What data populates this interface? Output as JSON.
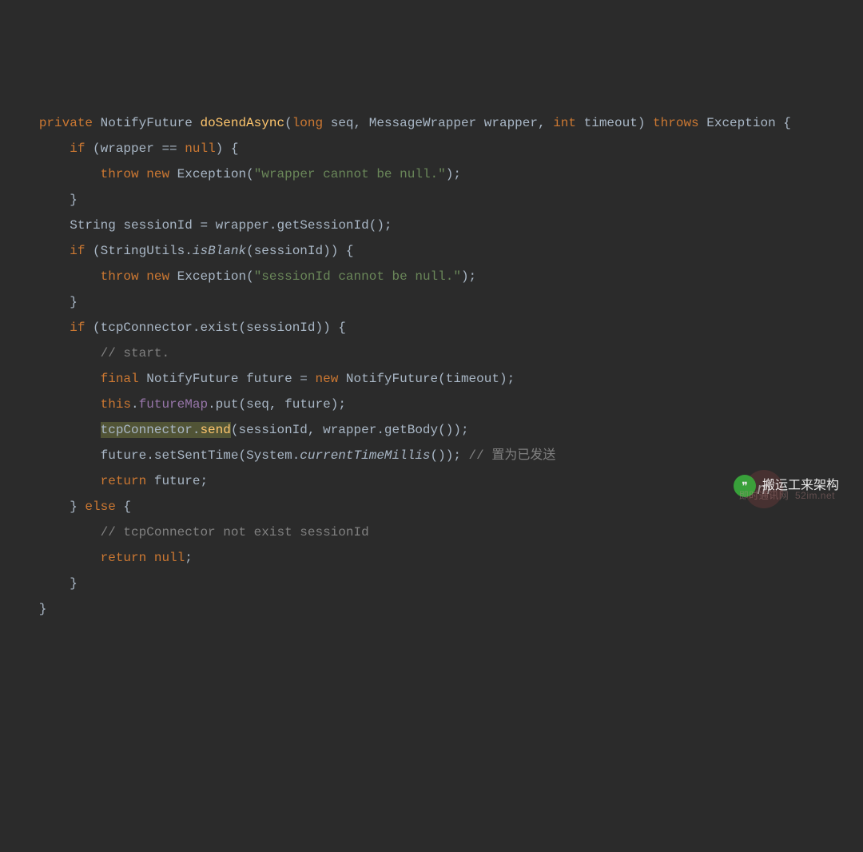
{
  "code": {
    "l1": {
      "kw_private": "private",
      "type1": "NotifyFuture",
      "method": "doSendAsync",
      "p1_type": "long",
      "p1_name": "seq",
      "p2_type": "MessageWrapper",
      "p2_name": "wrapper",
      "p3_type": "int",
      "p3_name": "timeout",
      "throws": "throws",
      "exc": "Exception"
    },
    "l2": {
      "kw_if": "if",
      "cond_l": "wrapper",
      "op": "==",
      "cond_r": "null"
    },
    "l3": {
      "kw_throw": "throw",
      "kw_new": "new",
      "type": "Exception",
      "str": "\"wrapper cannot be null.\""
    },
    "l5": {
      "type": "String",
      "var": "sessionId",
      "obj": "wrapper",
      "call": "getSessionId"
    },
    "l6": {
      "kw_if": "if",
      "cls": "StringUtils",
      "call": "isBlank",
      "arg": "sessionId"
    },
    "l7": {
      "kw_throw": "throw",
      "kw_new": "new",
      "type": "Exception",
      "str": "\"sessionId cannot be null.\""
    },
    "l9": {
      "kw_if": "if",
      "obj": "tcpConnector",
      "call": "exist",
      "arg": "sessionId"
    },
    "l10": {
      "comment": "// start."
    },
    "l11": {
      "kw_final": "final",
      "type": "NotifyFuture",
      "var": "future",
      "kw_new": "new",
      "ctor": "NotifyFuture",
      "arg": "timeout"
    },
    "l12": {
      "kw_this": "this",
      "field": "futureMap",
      "call": "put",
      "arg1": "seq",
      "arg2": "future"
    },
    "l13": {
      "obj": "tcpConnector",
      "call": "send",
      "arg1": "sessionId",
      "arg2_obj": "wrapper",
      "arg2_call": "getBody"
    },
    "l14": {
      "obj": "future",
      "call": "setSentTime",
      "cls": "System",
      "scall": "currentTimeMillis",
      "comment": "// 置为已发送"
    },
    "l15": {
      "kw_return": "return",
      "val": "future"
    },
    "l16": {
      "kw_else": "else"
    },
    "l17": {
      "comment": "// tcpConnector not exist sessionId"
    },
    "l18": {
      "kw_return": "return",
      "val": "null"
    }
  },
  "watermark": {
    "icon_text": "❞",
    "label": "搬运工来架构",
    "icon2": "m",
    "sub": "即时通讯网  52im.net"
  }
}
